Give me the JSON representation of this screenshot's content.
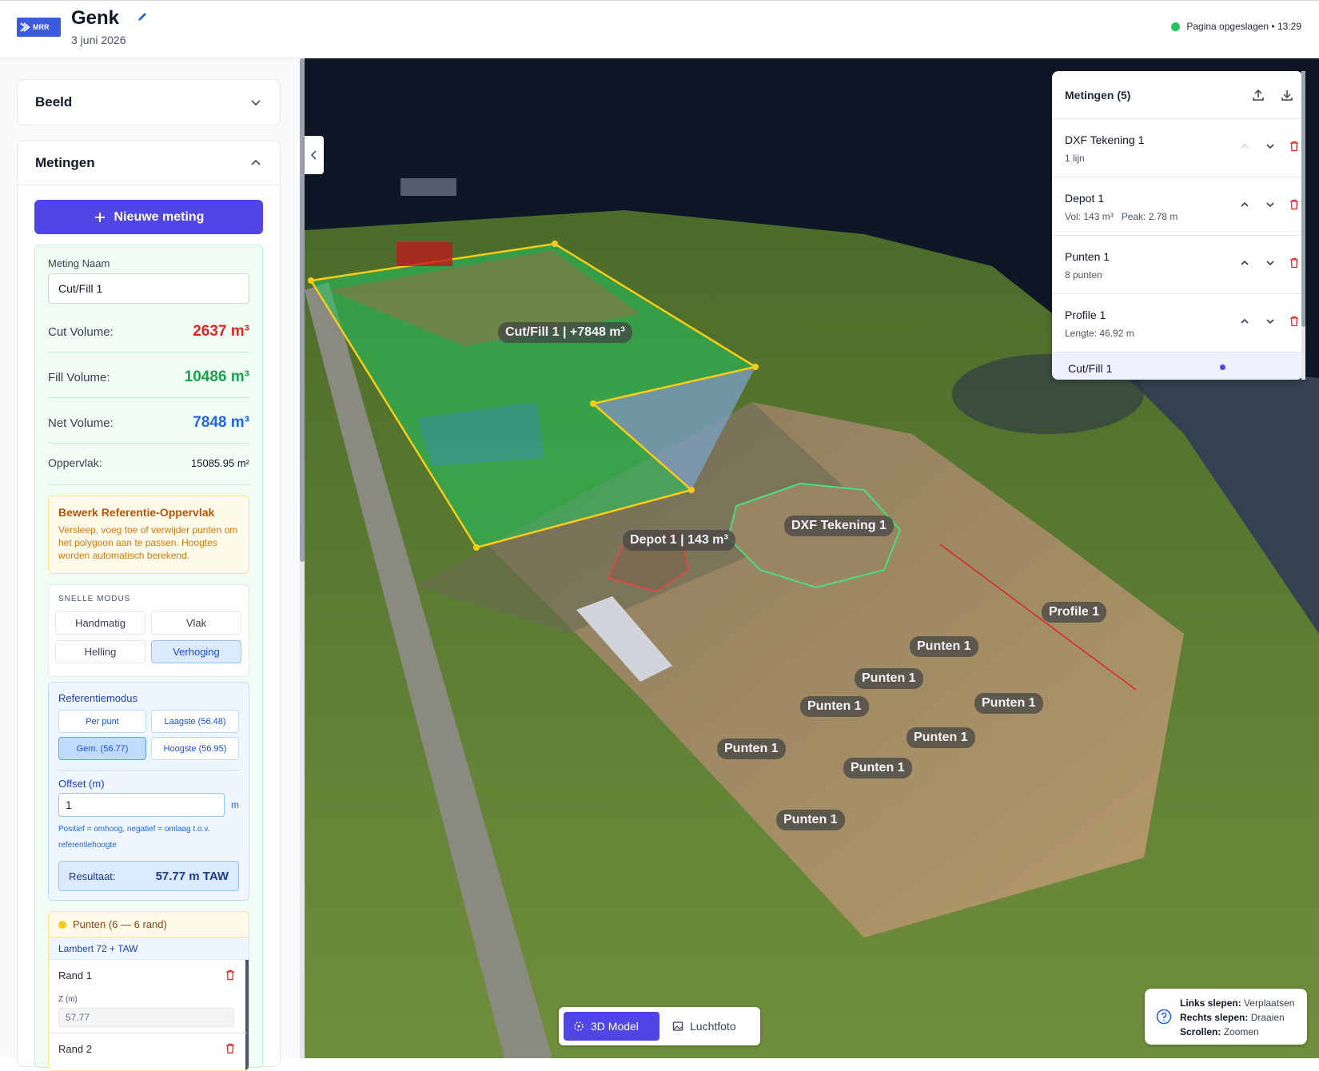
{
  "header": {
    "logo_text": "MRR",
    "title": "Genk",
    "date": "3 juni 2026",
    "saved_status": "Pagina opgeslagen • 13:29"
  },
  "sidebar": {
    "beeld_title": "Beeld",
    "metingen_title": "Metingen",
    "new_button": "Nieuwe meting",
    "name_label": "Meting Naam",
    "name_value": "Cut/Fill 1",
    "cut_label": "Cut Volume:",
    "cut_value": "2637 m³",
    "fill_label": "Fill Volume:",
    "fill_value": "10486 m³",
    "net_label": "Net Volume:",
    "net_value": "7848 m³",
    "area_label": "Oppervlak:",
    "area_value": "15085.95 m²",
    "warn_title": "Bewerk Referentie-Oppervlak",
    "warn_text": "Versleep, voeg toe of verwijder punten om het polygoon aan te passen. Hoogtes worden automatisch berekend.",
    "quick_title": "SNELLE MODUS",
    "quick_modes": [
      "Handmatig",
      "Vlak",
      "Helling",
      "Verhoging"
    ],
    "quick_active": "Verhoging",
    "ref_title": "Referentiemodus",
    "ref_modes": [
      "Per punt",
      "Laagste (56.48)",
      "Gem. (56.77)",
      "Hoogste (56.95)"
    ],
    "offset_label": "Offset (m)",
    "offset_value": "1",
    "offset_unit": "m",
    "offset_help": "Positief = omhoog, negatief = omlaag t.o.v. referentiehoogte",
    "result_label": "Resultaat:",
    "result_value": "57.77 m TAW",
    "points_title": "Punten (6 — 6 rand)",
    "points_crs": "Lambert 72 + TAW",
    "point_rows": [
      {
        "name": "Rand 1",
        "z_label": "Z (m)",
        "z_value": "57.77"
      },
      {
        "name": "Rand 2",
        "z_label": "",
        "z_value": ""
      }
    ]
  },
  "map": {
    "labels": {
      "cutfill": "Cut/Fill 1 | +7848 m³",
      "depot": "Depot 1 | 143 m³",
      "dxf": "DXF Tekening 1",
      "profile": "Profile 1",
      "punten": "Punten 1"
    }
  },
  "panel": {
    "title": "Metingen (5)",
    "items": [
      {
        "name": "DXF Tekening 1",
        "sub": "1 lijn"
      },
      {
        "name": "Depot 1",
        "sub": "Vol: 143 m³   Peak: 2.78 m"
      },
      {
        "name": "Punten 1",
        "sub": "8 punten"
      },
      {
        "name": "Profile 1",
        "sub": "Lengte: 46.92 m"
      },
      {
        "name": "Cut/Fill 1",
        "sub": ""
      }
    ]
  },
  "view_toggle": {
    "model": "3D Model",
    "photo": "Luchtfoto",
    "active": "3D Model"
  },
  "help": {
    "left_key": "Links slepen:",
    "left_val": "Verplaatsen",
    "right_key": "Rechts slepen:",
    "right_val": "Draaien",
    "scroll_key": "Scrollen:",
    "scroll_val": "Zoomen"
  },
  "colors": {
    "accent": "#4f46e5",
    "cut": "#dc2626",
    "fill": "#16a34a",
    "net": "#2563eb"
  }
}
